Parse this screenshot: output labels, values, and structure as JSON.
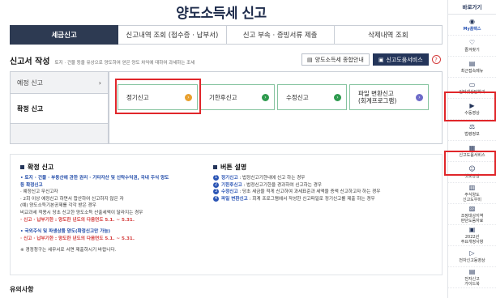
{
  "title": "양도소득세 신고",
  "tabs": [
    "세금신고",
    "신고내역 조회 (접수증 · 납부서)",
    "신고 부속 · 증빙서류 제출",
    "삭제내역 조회"
  ],
  "section": {
    "title": "신고서 작성",
    "desc": "토지 · 건물 등을 유상으로 양도하여 얻은 양도 차익에 대하여 과세하는 조세",
    "btn_info": "양도소득세 종합안내",
    "btn_help": "신고도움서비스",
    "help_icon": "?"
  },
  "left_menu": [
    {
      "label": "예정 신고",
      "arrow": "›"
    },
    {
      "label": "확정 신고",
      "arrow": ""
    }
  ],
  "cards": [
    {
      "label": "정기신고",
      "icon": "›"
    },
    {
      "label": "기한후신고",
      "icon": "›"
    },
    {
      "label": "수정신고",
      "icon": "›"
    },
    {
      "label": "파일 변환신고\n(회계프로그램)",
      "icon": "›"
    }
  ],
  "confirm": {
    "title": "확정 신고",
    "lines": [
      "• 토지 · 건물 · 부동산에 관한 권리 · 기타자산 및 신탁수익권, 국내 주식 양도",
      "  등 확정신고",
      "· 예정신고 무신고자",
      "· 2회 이상 예정신고 하면서 합산하여 신고하지 않은 자",
      "  (예) 양도소득기본공제를 각각 받은 경우",
      "  비교과세 적용시 당초 신고한 양도소득 산출세액이 달라지는 경우",
      "· 신고 · 납부기한 : 양도한 년도의 다음연도 5.1. ~ 5.31.",
      "• 국외주식 및 파생상품 양도(확정신고만 가능)",
      "· 신고 · 납부기한 : 양도한 년도의 다음연도 5.1. ~ 5.31.",
      "※ 경정청구는 세무서로 서면 제출하시기 바랍니다."
    ]
  },
  "buttons_desc": {
    "title": "버튼 설명",
    "items": [
      {
        "num": "1",
        "name": "정기신고",
        "desc": " : 법정신고기한내에 신고 하는 경우"
      },
      {
        "num": "2",
        "name": "기한후신고",
        "desc": " : 법정신고기한을 경과하여 신고하는 경우"
      },
      {
        "num": "3",
        "name": "수정신고",
        "desc": " : 당초 세금을 적게 신고하여 과세표준과 세액을 증액 신고하고자 하는 경우"
      },
      {
        "num": "4",
        "name": "파일 변환신고",
        "desc": " : 회계 프로그램에서 작성한 신고파일로 정기신고를 제출 하는 경우"
      }
    ]
  },
  "bottom_cut": "유의사항",
  "quick": {
    "head": "바로가기",
    "items": [
      {
        "label": "My홈택스",
        "icon": "person-icon",
        "glyph": "◉",
        "blue": true
      },
      {
        "label": "즐겨찾기",
        "icon": "heart-icon",
        "glyph": "♡",
        "blue": false
      },
      {
        "label": "최근접속메뉴",
        "icon": "recent-icon",
        "glyph": "▤",
        "blue": false
      },
      {
        "label": "인터넷상담하기",
        "icon": "chat-icon",
        "glyph": "▭",
        "blue": false
      },
      {
        "label": "수동영상",
        "icon": "video-icon",
        "glyph": "▶",
        "blue": false
      },
      {
        "label": "법령정보",
        "icon": "scale-icon",
        "glyph": "⚖",
        "blue": false
      },
      {
        "label": "신고도움서비스",
        "icon": "doc-icon",
        "glyph": "▦",
        "blue": false
      },
      {
        "label": "챗봇상담",
        "icon": "chatbot-icon",
        "glyph": "☺",
        "blue": false
      },
      {
        "label": "주식양도\n신고도우미",
        "icon": "stock-icon",
        "glyph": "▥",
        "blue": false
      },
      {
        "label": "조정대상지역\n판단도움자료",
        "icon": "map-icon",
        "glyph": "▨",
        "blue": false
      },
      {
        "label": "2022년\n주요개정사항",
        "icon": "book-icon",
        "glyph": "▣",
        "blue": false
      },
      {
        "label": "전자신고동영상",
        "icon": "play-icon",
        "glyph": "▷",
        "blue": false
      },
      {
        "label": "전자신고\n가이드북",
        "icon": "guide-icon",
        "glyph": "▤",
        "blue": false
      }
    ]
  }
}
